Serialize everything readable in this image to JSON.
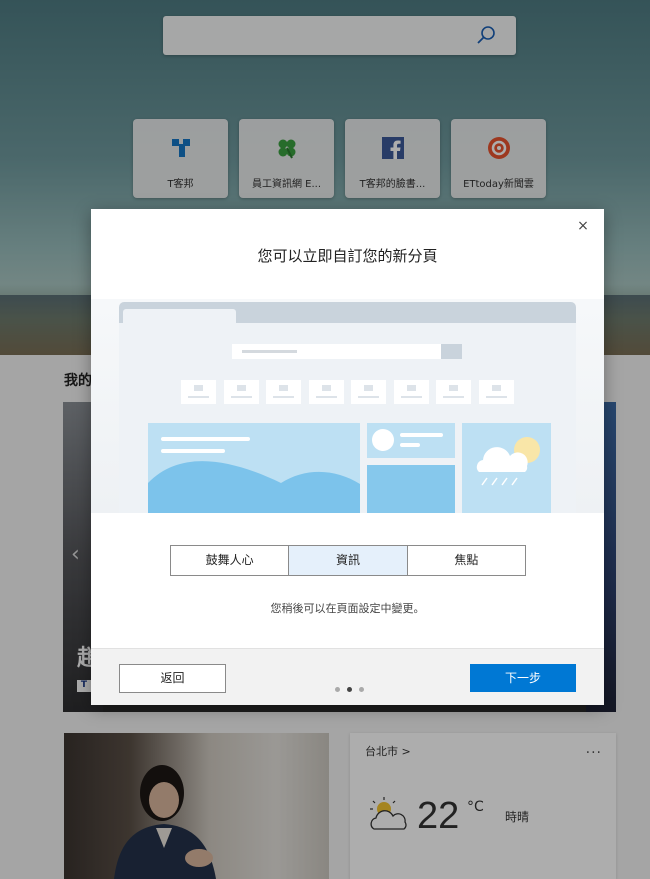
{
  "search": {
    "value": ""
  },
  "tiles": [
    {
      "label": "T客邦",
      "icon": "tkb-icon"
    },
    {
      "label": "員工資訊網 E...",
      "icon": "clover-icon"
    },
    {
      "label": "T客邦的臉書...",
      "icon": "facebook-icon"
    },
    {
      "label": "ETtoday新聞雲",
      "icon": "ettoday-icon"
    }
  ],
  "section": {
    "title": "我的",
    "right": "s"
  },
  "news": {
    "headline": "趙",
    "source_badge": "T"
  },
  "weather": {
    "city": "台北市 >",
    "more": "...",
    "temp": "22",
    "unit": "°C",
    "condition": "時晴"
  },
  "dialog": {
    "title": "您可以立即自訂您的新分頁",
    "close": "×",
    "options": [
      "鼓舞人心",
      "資訊",
      "焦點"
    ],
    "selected": "資訊",
    "hint": "您稍後可以在頁面設定中變更。",
    "back": "返回",
    "next": "下一步",
    "pages": 3,
    "current_page": 2
  },
  "colors": {
    "accent": "#0078d4",
    "selected_option": "#e5f0fb"
  }
}
